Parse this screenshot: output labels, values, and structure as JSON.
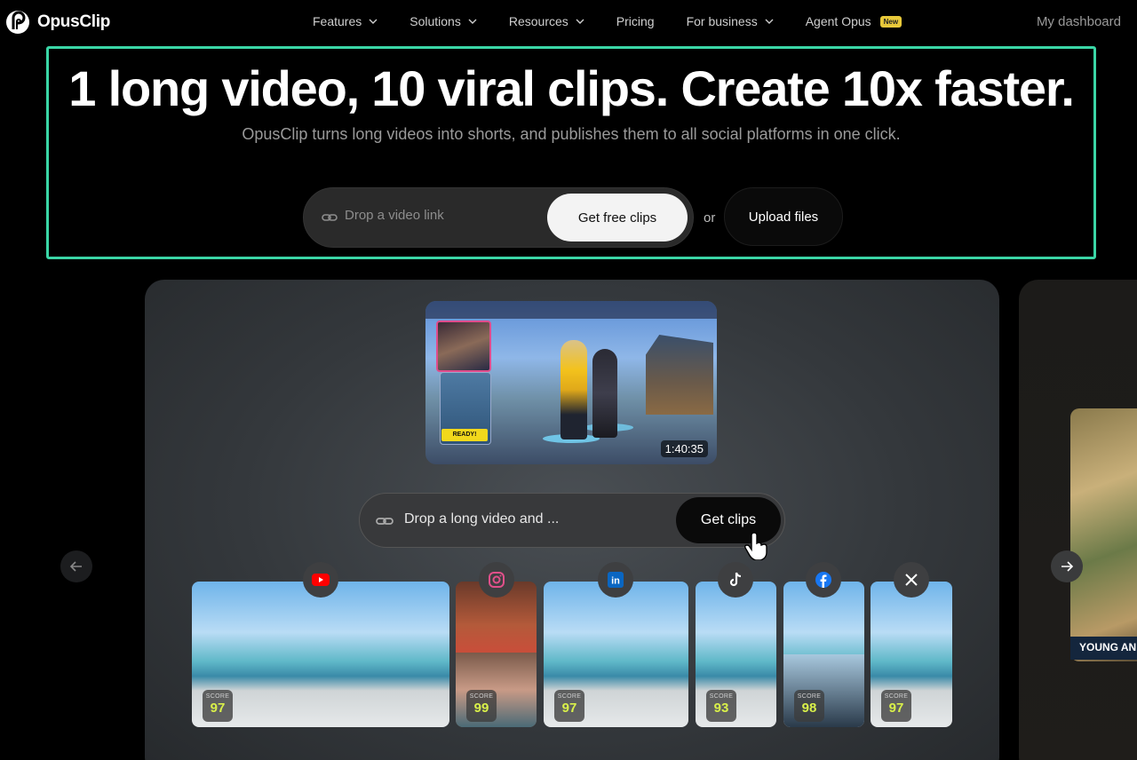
{
  "brand": {
    "name": "OpusClip"
  },
  "nav": {
    "items": [
      {
        "label": "Features",
        "has_dropdown": true
      },
      {
        "label": "Solutions",
        "has_dropdown": true
      },
      {
        "label": "Resources",
        "has_dropdown": true
      },
      {
        "label": "Pricing",
        "has_dropdown": false
      },
      {
        "label": "For business",
        "has_dropdown": true
      },
      {
        "label": "Agent Opus",
        "has_dropdown": false,
        "badge": "New"
      }
    ],
    "dashboard_label": "My dashboard"
  },
  "hero": {
    "headline": "1 long video, 10 viral clips. Create 10x faster.",
    "subheadline": "OpusClip turns long videos into shorts, and publishes them to all social platforms in one click.",
    "link_placeholder": "Drop a video link",
    "get_free_clips_label": "Get free clips",
    "or_label": "or",
    "upload_label": "Upload files"
  },
  "demo": {
    "video_duration": "1:40:35",
    "video_ready_label": "READY!",
    "input_text": "Drop a long video and ...",
    "get_clips_label": "Get clips",
    "peek_caption": "YOUNG AN",
    "clips": [
      {
        "platform": "youtube",
        "platform_icon": "youtube-icon",
        "score_label": "SCORE",
        "score": "97"
      },
      {
        "platform": "instagram",
        "platform_icon": "instagram-icon",
        "score_label": "SCORE",
        "score": "99"
      },
      {
        "platform": "linkedin",
        "platform_icon": "linkedin-icon",
        "score_label": "SCORE",
        "score": "97"
      },
      {
        "platform": "tiktok",
        "platform_icon": "tiktok-icon",
        "score_label": "SCORE",
        "score": "93"
      },
      {
        "platform": "facebook",
        "platform_icon": "facebook-icon",
        "score_label": "SCORE",
        "score": "98"
      },
      {
        "platform": "x",
        "platform_icon": "x-icon",
        "score_label": "SCORE",
        "score": "97"
      }
    ]
  },
  "colors": {
    "accent_outline": "#3ad6a6",
    "score": "#d9f04a",
    "badge": "#e8c93a"
  }
}
